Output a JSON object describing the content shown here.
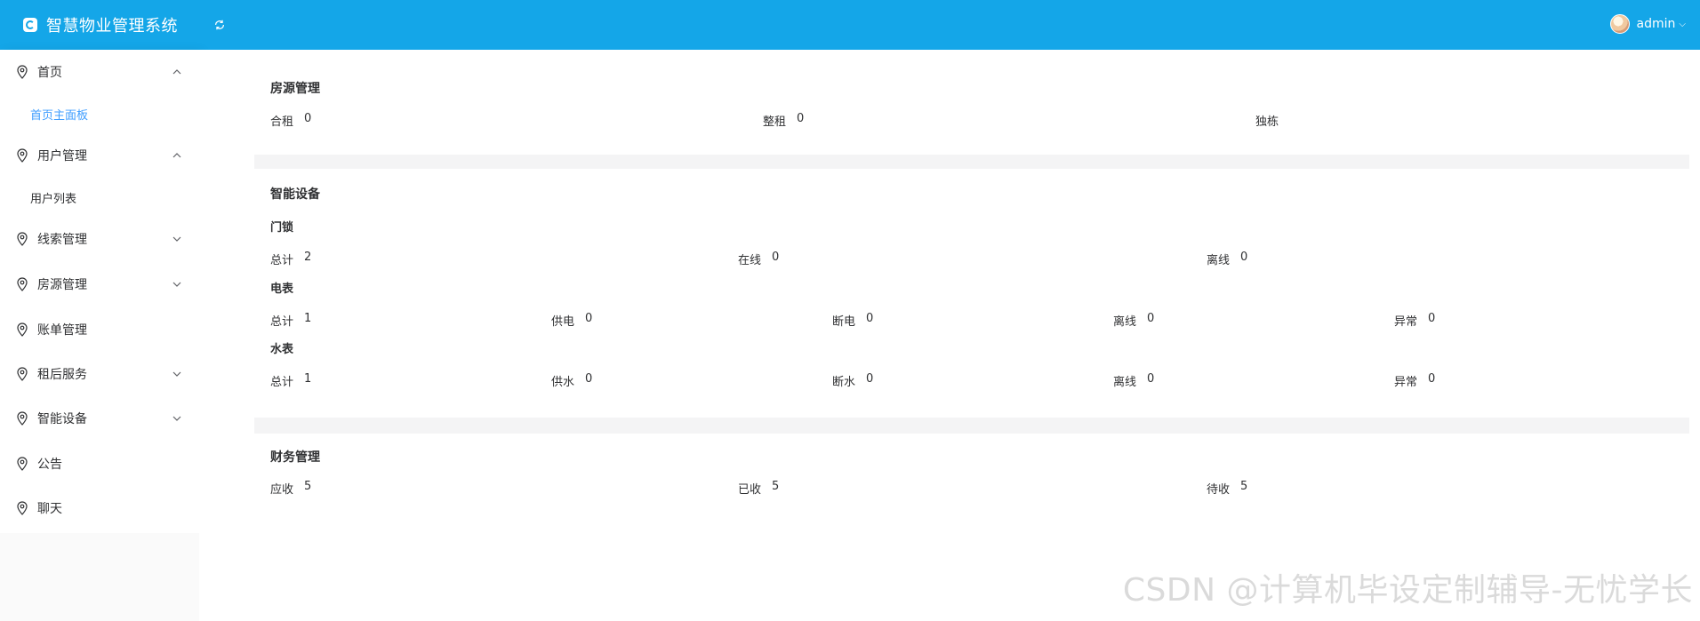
{
  "header": {
    "title": "智慧物业管理系统",
    "username": "admin"
  },
  "sidebar": {
    "items": [
      {
        "label": "首页"
      },
      {
        "label": "首页主面板"
      },
      {
        "label": "用户管理"
      },
      {
        "label": "用户列表"
      },
      {
        "label": "线索管理"
      },
      {
        "label": "房源管理"
      },
      {
        "label": "账单管理"
      },
      {
        "label": "租后服务"
      },
      {
        "label": "智能设备"
      },
      {
        "label": "公告"
      },
      {
        "label": "聊天"
      }
    ]
  },
  "house": {
    "title": "房源管理",
    "stats": [
      {
        "label": "合租",
        "value": "0"
      },
      {
        "label": "整租",
        "value": "0"
      },
      {
        "label": "独栋",
        "value": ""
      }
    ]
  },
  "devices": {
    "title": "智能设备",
    "lock": {
      "title": "门锁",
      "stats": [
        {
          "label": "总计",
          "value": "2"
        },
        {
          "label": "在线",
          "value": "0"
        },
        {
          "label": "离线",
          "value": "0"
        }
      ]
    },
    "meter": {
      "title": "电表",
      "stats": [
        {
          "label": "总计",
          "value": "1"
        },
        {
          "label": "供电",
          "value": "0"
        },
        {
          "label": "断电",
          "value": "0"
        },
        {
          "label": "离线",
          "value": "0"
        },
        {
          "label": "异常",
          "value": "0"
        }
      ]
    },
    "water": {
      "title": "水表",
      "stats": [
        {
          "label": "总计",
          "value": "1"
        },
        {
          "label": "供水",
          "value": "0"
        },
        {
          "label": "断水",
          "value": "0"
        },
        {
          "label": "离线",
          "value": "0"
        },
        {
          "label": "异常",
          "value": "0"
        }
      ]
    }
  },
  "finance": {
    "title": "财务管理",
    "stats": [
      {
        "label": "应收",
        "value": "5"
      },
      {
        "label": "已收",
        "value": "5"
      },
      {
        "label": "待收",
        "value": "5"
      }
    ]
  },
  "watermark": "CSDN @计算机毕设定制辅导-无忧学长",
  "colors": {
    "header": "#14a6e8",
    "active": "#409eff",
    "separator": "#f4f4f5"
  }
}
